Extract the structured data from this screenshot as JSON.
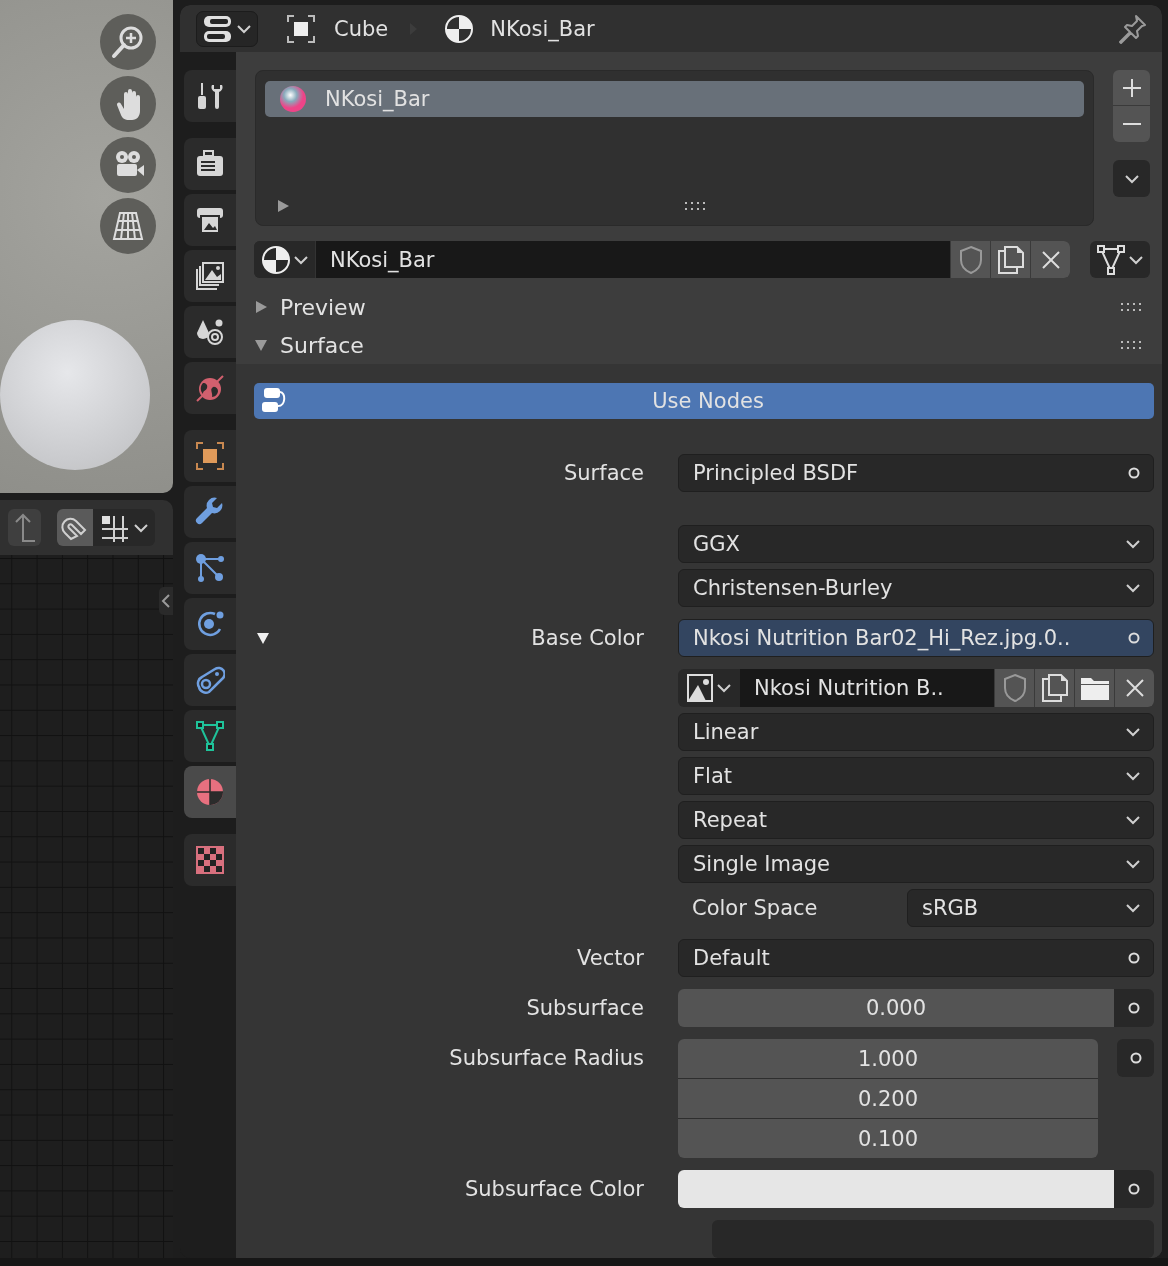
{
  "header": {
    "breadcrumbs": [
      "Cube",
      "NKosi_Bar"
    ]
  },
  "property_tabs": [
    [
      {
        "kind": "tool",
        "selected": false
      }
    ],
    [
      {
        "kind": "render",
        "selected": false
      },
      {
        "kind": "output",
        "selected": false
      },
      {
        "kind": "view_layer",
        "selected": false
      },
      {
        "kind": "scene",
        "selected": false
      },
      {
        "kind": "world",
        "selected": false
      }
    ],
    [
      {
        "kind": "object",
        "selected": false
      },
      {
        "kind": "modifiers",
        "selected": false
      },
      {
        "kind": "particles",
        "selected": false
      },
      {
        "kind": "physics",
        "selected": false
      },
      {
        "kind": "constraints",
        "selected": false
      },
      {
        "kind": "data",
        "selected": false
      },
      {
        "kind": "material",
        "selected": true
      }
    ],
    [
      {
        "kind": "texture",
        "selected": false
      }
    ]
  ],
  "material_slots": [
    {
      "label": "NKosi_Bar",
      "selected": true
    }
  ],
  "material_field": {
    "value": "NKosi_Bar"
  },
  "panels": [
    {
      "title": "Preview",
      "expanded": false
    },
    {
      "title": "Surface",
      "expanded": true
    }
  ],
  "use_nodes_button": "Use Nodes",
  "properties": [
    {
      "kind": "socket",
      "label": "Surface",
      "value": "Principled BSDF",
      "linked": false
    },
    {
      "kind": "dropdown",
      "value": "GGX"
    },
    {
      "kind": "dropdown",
      "value": "Christensen-Burley"
    },
    {
      "kind": "socket",
      "label": "Base Color",
      "value": "Nkosi Nutrition Bar02_Hi_Rez.jpg.0..",
      "linked": true,
      "expanded": true
    },
    {
      "kind": "image",
      "value": "Nkosi Nutrition B.."
    },
    {
      "kind": "dropdown",
      "value": "Linear"
    },
    {
      "kind": "dropdown",
      "value": "Flat"
    },
    {
      "kind": "dropdown",
      "value": "Repeat"
    },
    {
      "kind": "dropdown",
      "value": "Single Image"
    },
    {
      "kind": "pair",
      "label": "Color Space",
      "value": "sRGB"
    },
    {
      "kind": "socket",
      "label": "Vector",
      "value": "Default",
      "linked": false
    },
    {
      "kind": "number",
      "label": "Subsurface",
      "value": "0.000"
    },
    {
      "kind": "vector",
      "label": "Subsurface Radius",
      "values": [
        "1.000",
        "0.200",
        "0.100"
      ]
    },
    {
      "kind": "color",
      "label": "Subsurface Color",
      "color": "#e6e6e6"
    }
  ]
}
